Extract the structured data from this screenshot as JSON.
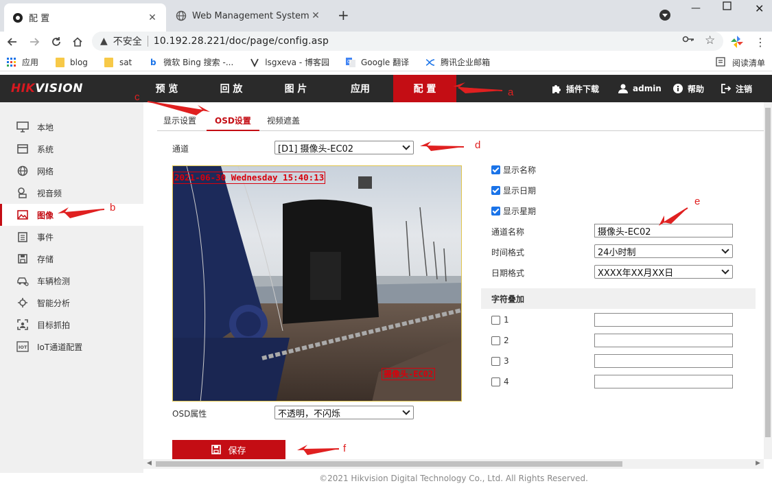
{
  "browser": {
    "tabs": [
      {
        "title": "配 置",
        "favicon": "hikvision-favicon",
        "active": true
      },
      {
        "title": "Web Management System",
        "favicon": "globe-icon",
        "active": false
      }
    ],
    "address": {
      "security_label": "不安全",
      "url": "10.192.28.221/doc/page/config.asp"
    },
    "bookmarks": [
      {
        "label": "应用",
        "icon": "apps-grid-icon"
      },
      {
        "label": "blog",
        "icon": "folder-icon"
      },
      {
        "label": "sat",
        "icon": "folder-icon"
      },
      {
        "label": "微软 Bing 搜索 -...",
        "icon": "bing-icon"
      },
      {
        "label": "lsgxeva - 博客园",
        "icon": "cnblogs-icon"
      },
      {
        "label": "Google 翻译",
        "icon": "google-translate-icon"
      },
      {
        "label": "腾讯企业邮箱",
        "icon": "tencent-mail-icon"
      }
    ],
    "reading_list": "阅读清单"
  },
  "app": {
    "logo": {
      "red": "HIK",
      "white": "VISION"
    },
    "nav": [
      {
        "label": "预 览"
      },
      {
        "label": "回 放"
      },
      {
        "label": "图 片"
      },
      {
        "label": "应用"
      },
      {
        "label": "配 置",
        "active": true
      }
    ],
    "right_nav": [
      {
        "label": "插件下载",
        "icon": "puzzle-icon"
      },
      {
        "label": "admin",
        "icon": "user-icon"
      },
      {
        "label": "帮助",
        "icon": "info-icon"
      },
      {
        "label": "注销",
        "icon": "logout-icon"
      }
    ],
    "sidebar": [
      {
        "label": "本地",
        "icon": "monitor-icon"
      },
      {
        "label": "系统",
        "icon": "system-icon"
      },
      {
        "label": "网络",
        "icon": "globe-icon"
      },
      {
        "label": "视音频",
        "icon": "video-audio-icon"
      },
      {
        "label": "图像",
        "icon": "image-icon",
        "active": true
      },
      {
        "label": "事件",
        "icon": "calendar-icon"
      },
      {
        "label": "存储",
        "icon": "storage-icon"
      },
      {
        "label": "车辆检测",
        "icon": "car-icon"
      },
      {
        "label": "智能分析",
        "icon": "analysis-icon"
      },
      {
        "label": "目标抓拍",
        "icon": "capture-icon"
      },
      {
        "label": "IoT通道配置",
        "icon": "iot-icon"
      }
    ],
    "subtabs": [
      {
        "label": "显示设置"
      },
      {
        "label": "OSD设置",
        "active": true
      },
      {
        "label": "视频遮盖"
      }
    ],
    "form": {
      "channel_label": "通道",
      "channel_value": "[D1] 摄像头-EC02",
      "show_name": {
        "label": "显示名称",
        "checked": true
      },
      "show_date": {
        "label": "显示日期",
        "checked": true
      },
      "show_week": {
        "label": "显示星期",
        "checked": true
      },
      "channel_name_label": "通道名称",
      "channel_name_value": "摄像头-EC02",
      "time_format_label": "时间格式",
      "time_format_value": "24小时制",
      "date_format_label": "日期格式",
      "date_format_value": "XXXX年XX月XX日",
      "char_overlay_title": "字符叠加",
      "overlays": [
        {
          "label": "1",
          "checked": false,
          "value": ""
        },
        {
          "label": "2",
          "checked": false,
          "value": ""
        },
        {
          "label": "3",
          "checked": false,
          "value": ""
        },
        {
          "label": "4",
          "checked": false,
          "value": ""
        }
      ],
      "osd_attr_label": "OSD属性",
      "osd_attr_value": "不透明，不闪烁",
      "save_label": "保存"
    },
    "preview": {
      "osd_datetime": "2021-06-30 Wednesday 15:40:13",
      "osd_channel": "摄像头-EC02"
    },
    "footer": "©2021 Hikvision Digital Technology Co., Ltd. All Rights Reserved."
  },
  "annotations": [
    "a",
    "b",
    "c",
    "d",
    "e",
    "f"
  ],
  "colors": {
    "brand_red": "#c40d14",
    "header_dark": "#2a2a2a",
    "annotation_red": "#e02020",
    "checkbox_blue": "#1a73e8"
  }
}
